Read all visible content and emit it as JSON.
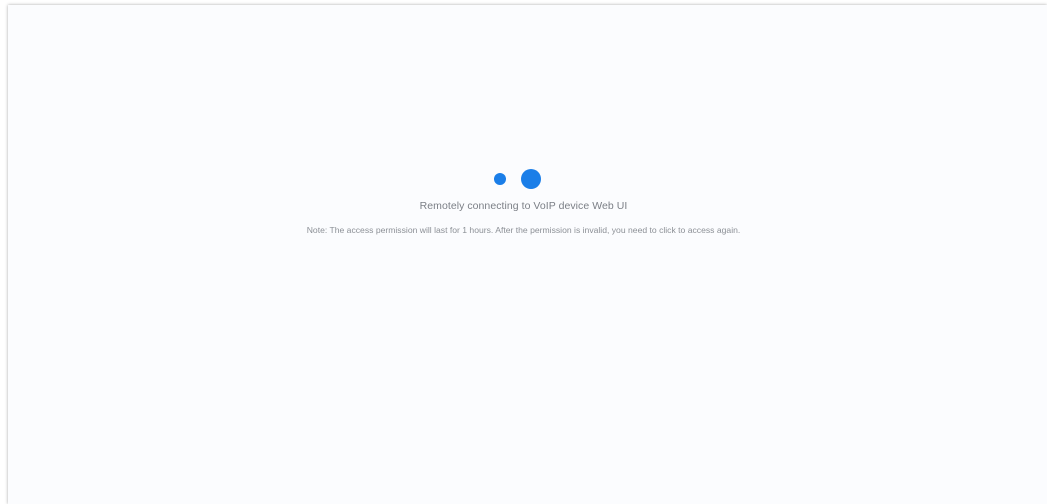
{
  "loading": {
    "status": "Remotely connecting to VoIP device Web UI",
    "note": "Note: The access permission will last for 1 hours. After the permission is invalid, you need to click to access again.",
    "spinner_icon": "loading-dots-icon",
    "accent_color": "#1a7ee8"
  }
}
